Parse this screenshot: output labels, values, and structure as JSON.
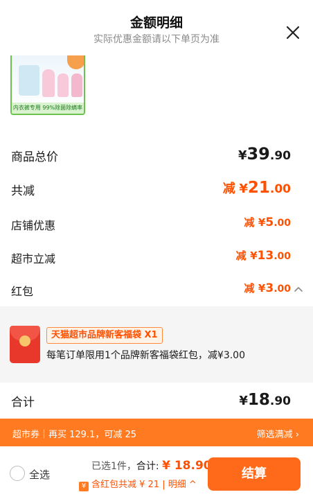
{
  "header": {
    "title": "金额明细",
    "subtitle": "实际优惠金额请以下单页为准"
  },
  "product": {
    "thumb_strip_text": "内衣裤专用 99%除菌除螨率"
  },
  "rows": {
    "goods_total": {
      "label": "商品总价",
      "currency": "¥",
      "int": "39",
      "dec": ".90"
    },
    "total_discount": {
      "label": "共减",
      "prefix": "减",
      "currency": "¥",
      "int": "21",
      "dec": ".00"
    },
    "store_discount": {
      "label": "店铺优惠",
      "prefix": "减",
      "currency": "¥",
      "int": "5",
      "dec": ".00"
    },
    "market_discount": {
      "label": "超市立减",
      "prefix": "减",
      "currency": "¥",
      "int": "13",
      "dec": ".00"
    },
    "red_packet": {
      "label": "红包",
      "prefix": "减",
      "currency": "¥",
      "int": "3",
      "dec": ".00"
    }
  },
  "coupon": {
    "tag": "天猫超市品牌新客福袋 X1",
    "desc": "每笔订单限用1个品牌新客福袋红包，减¥3.00"
  },
  "total": {
    "label": "合计",
    "currency": "¥",
    "int": "18",
    "dec": ".90"
  },
  "promo": {
    "left": "超市券｜再买 129.1，可减 25",
    "right": "筛选满减 ›"
  },
  "bottom": {
    "select_all": "全选",
    "selected_text": "已选1件，",
    "sum_label": "合计: ",
    "sum_value": "¥ 18.90",
    "badge": "¥",
    "discount_text": "含红包共减 ¥ 21 | 明细 ^",
    "checkout": "结算"
  },
  "colors": {
    "accent": "#ff5000",
    "promo_bar": "#ff7a21",
    "checkout": "#ff6a1a"
  },
  "icons": {
    "close": "close-icon",
    "caret_up": "chevron-up-icon",
    "red_packet": "red-packet-icon",
    "radio": "radio-unchecked-icon"
  }
}
